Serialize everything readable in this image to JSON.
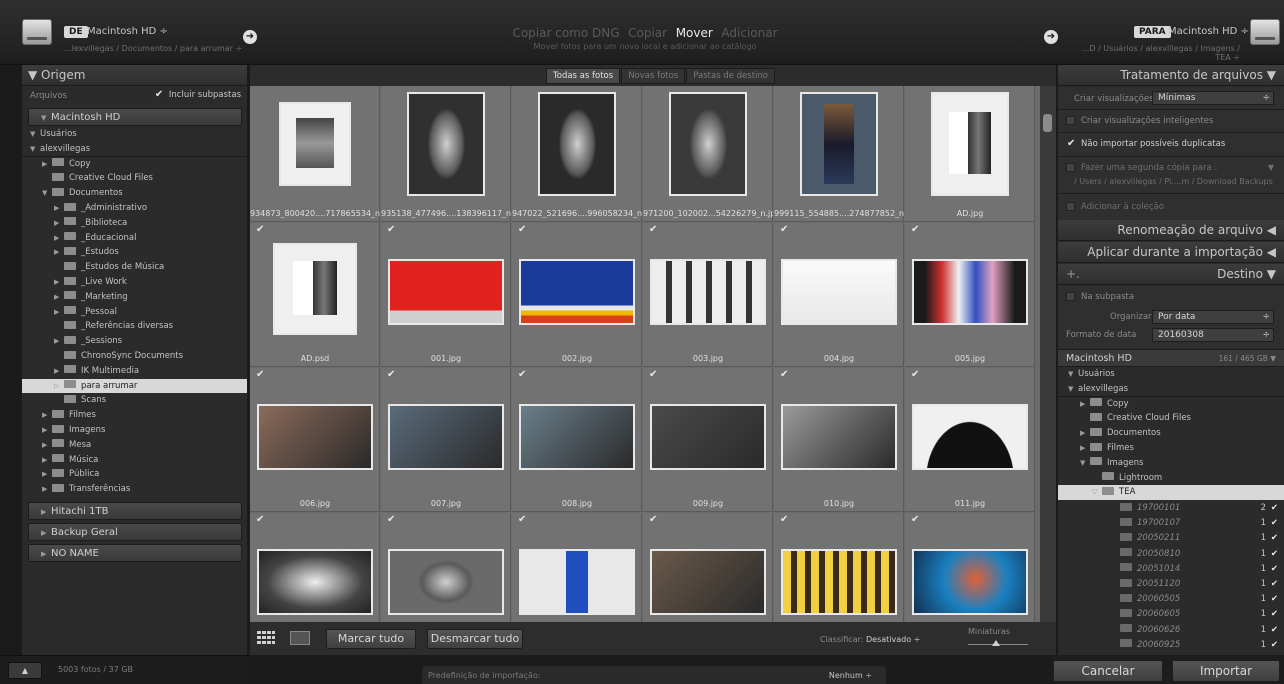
{
  "topbar": {
    "from_tag": "DE",
    "from_volume": "Macintosh HD ÷",
    "from_path": "...lexvillegas / Documentos / para arrumar ÷",
    "modes": [
      "Copiar como DNG",
      "Copiar",
      "Mover",
      "Adicionar"
    ],
    "active_mode_index": 2,
    "mode_description": "Mover fotos para um novo local e adicionar ao catálogo",
    "to_tag": "PARA",
    "to_volume": "Macintosh HD ÷",
    "to_path": "...D / Usuários / alexvillegas / Imagens / TEA ÷"
  },
  "left": {
    "source_title": "▼ Origem",
    "files_label": "Arquivos",
    "include_subfolders": "Incluir subpastas",
    "volume_main": "Macintosh HD",
    "tree": [
      {
        "label": "Usuários",
        "indent": 0,
        "tri": "▼",
        "folder": false
      },
      {
        "label": "alexvillegas",
        "indent": 0,
        "tri": "▼",
        "folder": false,
        "sep": true
      },
      {
        "label": "Copy",
        "indent": 1,
        "tri": "▶",
        "folder": true
      },
      {
        "label": "Creative Cloud Files",
        "indent": 1,
        "tri": "",
        "folder": true
      },
      {
        "label": "Documentos",
        "indent": 1,
        "tri": "▼",
        "folder": true
      },
      {
        "label": "_Administrativo",
        "indent": 2,
        "tri": "▶",
        "folder": true
      },
      {
        "label": "_Biblioteca",
        "indent": 2,
        "tri": "▶",
        "folder": true
      },
      {
        "label": "_Educacional",
        "indent": 2,
        "tri": "▶",
        "folder": true
      },
      {
        "label": "_Estudos",
        "indent": 2,
        "tri": "▶",
        "folder": true
      },
      {
        "label": "_Estudos de Música",
        "indent": 2,
        "tri": "",
        "folder": true
      },
      {
        "label": "_Live Work",
        "indent": 2,
        "tri": "▶",
        "folder": true
      },
      {
        "label": "_Marketing",
        "indent": 2,
        "tri": "▶",
        "folder": true
      },
      {
        "label": "_Pessoal",
        "indent": 2,
        "tri": "▶",
        "folder": true
      },
      {
        "label": "_Referências diversas",
        "indent": 2,
        "tri": "",
        "folder": true
      },
      {
        "label": "_Sessions",
        "indent": 2,
        "tri": "▶",
        "folder": true
      },
      {
        "label": "ChronoSync Documents",
        "indent": 2,
        "tri": "",
        "folder": true
      },
      {
        "label": "IK Multimedia",
        "indent": 2,
        "tri": "▶",
        "folder": true
      },
      {
        "label": "para arrumar",
        "indent": 2,
        "tri": "▷",
        "folder": true,
        "selected": true
      },
      {
        "label": "Scans",
        "indent": 2,
        "tri": "",
        "folder": true
      },
      {
        "label": "Filmes",
        "indent": 1,
        "tri": "▶",
        "folder": true
      },
      {
        "label": "Imagens",
        "indent": 1,
        "tri": "▶",
        "folder": true
      },
      {
        "label": "Mesa",
        "indent": 1,
        "tri": "▶",
        "folder": true
      },
      {
        "label": "Música",
        "indent": 1,
        "tri": "▶",
        "folder": true
      },
      {
        "label": "Pública",
        "indent": 1,
        "tri": "▶",
        "folder": true
      },
      {
        "label": "Transferências",
        "indent": 1,
        "tri": "▶",
        "folder": true
      }
    ],
    "volumes": [
      "Hitachi 1TB",
      "Backup Geral",
      "NO NAME"
    ],
    "status": "5003 fotos / 37 GB"
  },
  "center": {
    "tabs": [
      "Todas as fotos",
      "Novas fotos",
      "Pastas de destino"
    ],
    "active_tab_index": 0,
    "photos": [
      {
        "name": "934873_800420....717865534_n.jpg",
        "thumb": "portrait-frame",
        "bg": "#efefef",
        "checked": false
      },
      {
        "name": "935138_477496....138396117_n.jpg",
        "thumb": "bw-portrait",
        "bg": "#303030",
        "checked": false
      },
      {
        "name": "947022_521696....996058234_n.jpg",
        "thumb": "bw-smoke",
        "bg": "#2a2a2a",
        "checked": false
      },
      {
        "name": "971200_102002...54226279_n.jpg",
        "thumb": "bw-man",
        "bg": "#3a3a3a",
        "checked": false
      },
      {
        "name": "999115_554885....274877852_n.jpg",
        "thumb": "color-woman",
        "bg": "#4a5a6a",
        "checked": false
      },
      {
        "name": "AD.jpg",
        "thumb": "poster",
        "bg": "#efefef",
        "checked": false
      },
      {
        "name": "AD.psd",
        "thumb": "poster",
        "bg": "#efefef",
        "checked": true
      },
      {
        "name": "001.jpg",
        "thumb": "red-wall",
        "bg": "#d81b1b",
        "checked": true
      },
      {
        "name": "002.jpg",
        "thumb": "blue-wall",
        "bg": "#1d3f9b",
        "checked": true
      },
      {
        "name": "003.jpg",
        "thumb": "windows",
        "bg": "#bfbfbf",
        "checked": true
      },
      {
        "name": "004.jpg",
        "thumb": "white-wall",
        "bg": "#f2f2f2",
        "checked": true
      },
      {
        "name": "005.jpg",
        "thumb": "mannequins",
        "bg": "#2a2a2a",
        "checked": true
      },
      {
        "name": "006.jpg",
        "thumb": "graffiti",
        "bg": "#8b6b5a",
        "checked": true
      },
      {
        "name": "007.jpg",
        "thumb": "street",
        "bg": "#5a6b7b",
        "checked": true
      },
      {
        "name": "008.jpg",
        "thumb": "facade",
        "bg": "#6a7f8a",
        "checked": true
      },
      {
        "name": "009.jpg",
        "thumb": "runner",
        "bg": "#4a4a4a",
        "checked": true
      },
      {
        "name": "010.jpg",
        "thumb": "building",
        "bg": "#9a9a9a",
        "checked": true
      },
      {
        "name": "011.jpg",
        "thumb": "curve",
        "bg": "#e8e8e8",
        "checked": true
      },
      {
        "name": "",
        "thumb": "tunnel",
        "bg": "#6a6a6a",
        "checked": true
      },
      {
        "name": "",
        "thumb": "bw-street",
        "bg": "#6a6a6a",
        "checked": true
      },
      {
        "name": "",
        "thumb": "blue-door",
        "bg": "#d8d8d8",
        "checked": true
      },
      {
        "name": "",
        "thumb": "tram",
        "bg": "#6a5a4a",
        "checked": true
      },
      {
        "name": "",
        "thumb": "pattern",
        "bg": "#6a5a2a",
        "checked": true
      },
      {
        "name": "",
        "thumb": "face-paint",
        "bg": "#1a6aa8",
        "checked": true
      }
    ],
    "select_all": "Marcar tudo",
    "deselect_all": "Desmarcar tudo",
    "sort_label": "Classificar:",
    "sort_value": "Desativado ÷",
    "thumbnails_label": "Miniaturas",
    "preset_label": "Predefinição de importação:",
    "preset_value": "Nenhum ÷"
  },
  "right": {
    "file_handling_title": "Tratamento de arquivos ▼",
    "build_previews_label": "Criar visualizações",
    "build_previews_value": "Mínimas",
    "smart_previews": "Criar visualizações inteligentes",
    "no_duplicates": "Não importar possíveis duplicatas",
    "second_copy": "Fazer uma segunda cópia para :",
    "second_copy_path": "/ Users / alexvillegas / Pi....m / Download Backups",
    "add_collection": "Adicionar à coleção",
    "rename_title": "Renomeação de arquivo ◀",
    "apply_title": "Aplicar durante a importação ◀",
    "dest_title": "Destino ▼",
    "dest_plus": "+.",
    "into_subfolder": "Na subpasta",
    "organize_label": "Organizar",
    "organize_value": "Por data",
    "date_format_label": "Formato de data",
    "date_format_value": "20160308",
    "dest_volume": "Macintosh HD",
    "dest_volume_info": "161 / 465 GB ▼",
    "dest_tree": [
      {
        "label": "Usuários",
        "indent": 0,
        "tri": "▼"
      },
      {
        "label": "alexvillegas",
        "indent": 0,
        "tri": "▼",
        "sep": true
      },
      {
        "label": "Copy",
        "indent": 1,
        "tri": "▶"
      },
      {
        "label": "Creative Cloud Files",
        "indent": 1,
        "tri": ""
      },
      {
        "label": "Documentos",
        "indent": 1,
        "tri": "▶"
      },
      {
        "label": "Filmes",
        "indent": 1,
        "tri": "▶"
      },
      {
        "label": "Imagens",
        "indent": 1,
        "tri": "▼"
      },
      {
        "label": "Lightroom",
        "indent": 2,
        "tri": ""
      },
      {
        "label": "TEA",
        "indent": 2,
        "tri": "▽",
        "selected": true
      }
    ],
    "dates": [
      {
        "label": "19700101",
        "count": "2"
      },
      {
        "label": "19700107",
        "count": "1"
      },
      {
        "label": "20050211",
        "count": "1"
      },
      {
        "label": "20050810",
        "count": "1"
      },
      {
        "label": "20051014",
        "count": "1"
      },
      {
        "label": "20051120",
        "count": "1"
      },
      {
        "label": "20060505",
        "count": "1"
      },
      {
        "label": "20060605",
        "count": "1"
      },
      {
        "label": "20060626",
        "count": "1"
      },
      {
        "label": "20060925",
        "count": "1"
      }
    ],
    "cancel": "Cancelar",
    "import": "Importar"
  }
}
